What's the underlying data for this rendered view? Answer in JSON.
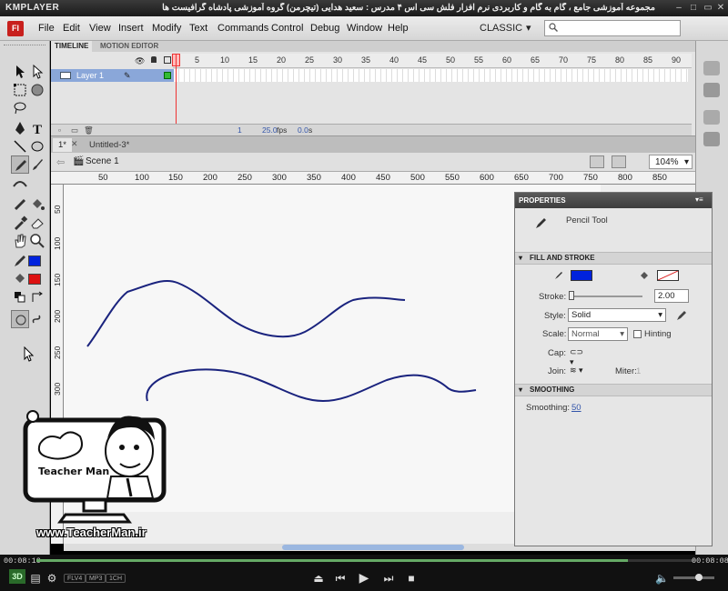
{
  "player": {
    "logo": "KMPLAYER",
    "caption": "مجموعه آموزشی جامع ، گام به گام و کاربردی نرم افزار فلش سی اس ۴ مدرس : سعید هدایی (تیچرمن) گروه آموزشی پادشاه گرافیست ها",
    "time_elapsed": "00:08:10",
    "time_total": "00:08:08",
    "badge_3d": "3D",
    "badges": [
      "FLV4",
      "MP3",
      "1CH"
    ]
  },
  "menu": {
    "logo": "Fl",
    "items": [
      "File",
      "Edit",
      "View",
      "Insert",
      "Modify",
      "Text",
      "Commands",
      "Control",
      "Debug",
      "Window",
      "Help"
    ],
    "workspace": "CLASSIC",
    "search_placeholder": ""
  },
  "timeline": {
    "tabs": [
      "TIMELINE",
      "MOTION EDITOR"
    ],
    "frame_numbers": [
      "5",
      "10",
      "15",
      "20",
      "25",
      "30",
      "35",
      "40",
      "45",
      "50",
      "55",
      "60",
      "65",
      "70",
      "75",
      "80",
      "85",
      "90"
    ],
    "layer_name": "Layer 1",
    "current_frame": "1",
    "fps": "25.0",
    "fps_unit": "fps",
    "time": "0.0",
    "time_unit": "s"
  },
  "documents": {
    "tabs": [
      "1*",
      "Untitled-3*"
    ],
    "scene": "Scene 1",
    "zoom": "104%"
  },
  "rulers": {
    "horizontal": [
      "50",
      "100",
      "150",
      "200",
      "250",
      "300",
      "350",
      "400",
      "450",
      "500",
      "550",
      "600",
      "650",
      "700",
      "750",
      "800",
      "850"
    ],
    "vertical": [
      "50",
      "100",
      "150",
      "200",
      "250",
      "300"
    ]
  },
  "properties": {
    "title": "PROPERTIES",
    "tool_name": "Pencil Tool",
    "fill_stroke_title": "FILL AND STROKE",
    "stroke_label": "Stroke:",
    "stroke_value": "2.00",
    "stroke_color": "#0022dd",
    "style_label": "Style:",
    "style_value": "Solid",
    "scale_label": "Scale:",
    "scale_value": "Normal",
    "hinting_label": "Hinting",
    "cap_label": "Cap:",
    "join_label": "Join:",
    "miter_label": "Miter:",
    "miter_value": "1",
    "smoothing_title": "SMOOTHING",
    "smoothing_label": "Smoothing:",
    "smoothing_value": "50"
  },
  "watermark": {
    "name": "Teacher Man",
    "url": "www.TeacherMan.ir"
  },
  "colors": {
    "stroke_blue": "#1a237e",
    "fill_blue": "#0022dd",
    "tool_fill_red": "#dd1111",
    "layer_highlight": "#8aa7d9"
  }
}
